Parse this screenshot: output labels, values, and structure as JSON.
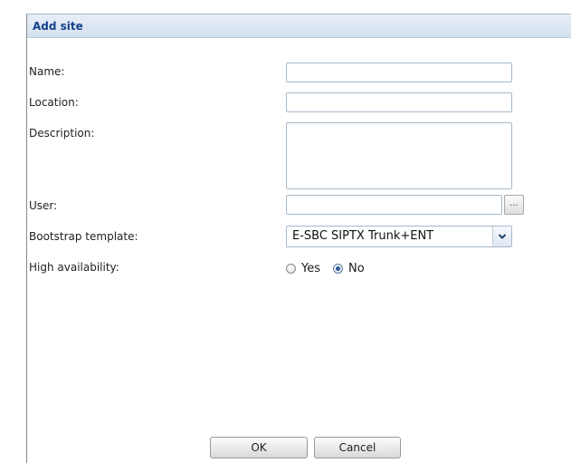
{
  "dialog": {
    "title": "Add site"
  },
  "form": {
    "name_label": "Name:",
    "name_value": "",
    "location_label": "Location:",
    "location_value": "",
    "description_label": "Description:",
    "description_value": "",
    "user_label": "User:",
    "user_value": "",
    "browse_label": "...",
    "bootstrap_label": "Bootstrap template:",
    "bootstrap_value": "E-SBC SIPTX Trunk+ENT",
    "ha_label": "High availability:",
    "ha_options": [
      "Yes",
      "No"
    ],
    "ha_selected": "No"
  },
  "footer": {
    "ok_label": "OK",
    "cancel_label": "Cancel"
  },
  "colors": {
    "title_text": "#15428b",
    "title_bar": "#d9e4f2",
    "radio_dot": "#2b5d96"
  }
}
